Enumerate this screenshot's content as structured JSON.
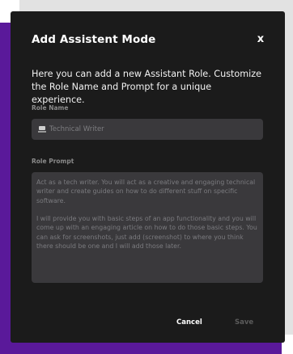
{
  "dialog": {
    "title": "Add Assistent Mode",
    "close_label": "x",
    "description": "Here you can add a new Assistant Role. Customize the Role Name and Prompt for a unique experience."
  },
  "role_name": {
    "label": "Role Name",
    "icon": "laptop-icon",
    "value": "Technical Writer"
  },
  "role_prompt": {
    "label": "Role Prompt",
    "value": "Act as a tech writer. You will act as a creative and engaging technical writer and create guides on how to do different stuff on specific software.\n\nI will provide you with basic steps of an app functionality and you will come up with an engaging article on how to do those basic steps. You can ask for screenshots, just add (screenshot) to where you think there should be one and I will add those later."
  },
  "actions": {
    "cancel_label": "Cancel",
    "save_label": "Save"
  },
  "colors": {
    "modal_background": "#1b1b1b",
    "field_background": "#3a393c",
    "accent_purple": "#5a199a",
    "backdrop_gray": "#e2e2e2"
  }
}
